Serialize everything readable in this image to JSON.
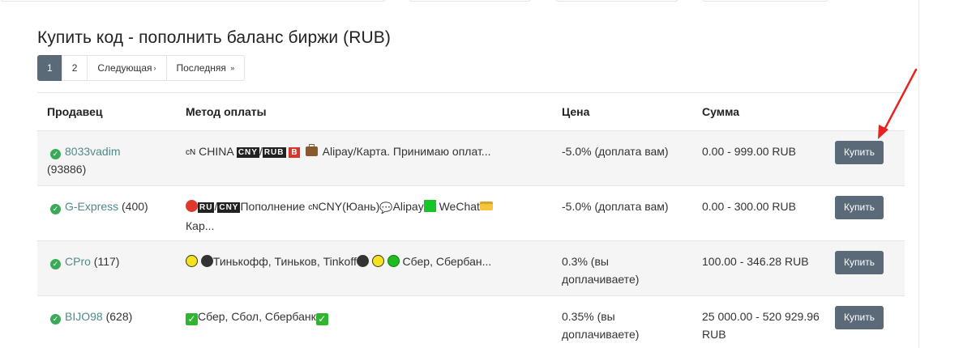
{
  "title": "Купить код - пополнить баланс биржи (RUB)",
  "pagination": {
    "pages": [
      "1",
      "2"
    ],
    "active": "1",
    "next": "Следующая",
    "next_arrow": "›",
    "last": "Последняя",
    "last_arrow": "»"
  },
  "table": {
    "headers": {
      "seller": "Продавец",
      "method": "Метод оплаты",
      "price": "Цена",
      "sum": "Сумма"
    },
    "rows": [
      {
        "seller": "8033vadim",
        "rating": "(93886)",
        "method_prefix": "cN",
        "method_country": "CHINA",
        "cur1": "CNY",
        "cur2": "RUB",
        "cur3": "B",
        "method_text": "Alipay/Карта. Принимаю оплат...",
        "price": "-5.0% (доплата вам)",
        "sum": "0.00 - 999.00 RUB",
        "button": "Купить"
      },
      {
        "seller": "G-Express",
        "rating": "(400)",
        "cur1": "RU",
        "cur2": "CNY",
        "method_text_a": "Пополнение",
        "method_prefix": "cN",
        "method_text_b": "CNY(Юань)",
        "method_text_c": "Alipay",
        "method_text_d": "WeChat",
        "method_text_e": "Кар...",
        "price": "-5.0% (доплата вам)",
        "sum": "0.00 - 300.00 RUB",
        "button": "Купить"
      },
      {
        "seller": "CPro",
        "rating": "(117)",
        "method_text_a": "Тинькофф, Тиньков, Tinkoff",
        "method_text_b": "Сбер, Сбербан...",
        "price": "0.3% (вы доплачиваете)",
        "sum": "100.00 - 346.28 RUB",
        "button": "Купить"
      },
      {
        "seller": "BIJO98",
        "rating": "(628)",
        "method_text": "Сбер, Сбол, Сбербанк",
        "price": "0.35% (вы доплачиваете)",
        "sum": "25 000.00 - 520 929.96 RUB",
        "button": "Купить"
      }
    ]
  },
  "colors": {
    "button_bg": "#5a6a78",
    "seller_link": "#4f8a8b",
    "verified": "#3aaa5a",
    "annotation_arrow": "#e8231f"
  },
  "icons": {
    "verified": "check-circle-icon",
    "annotation": "red-arrow-icon"
  }
}
